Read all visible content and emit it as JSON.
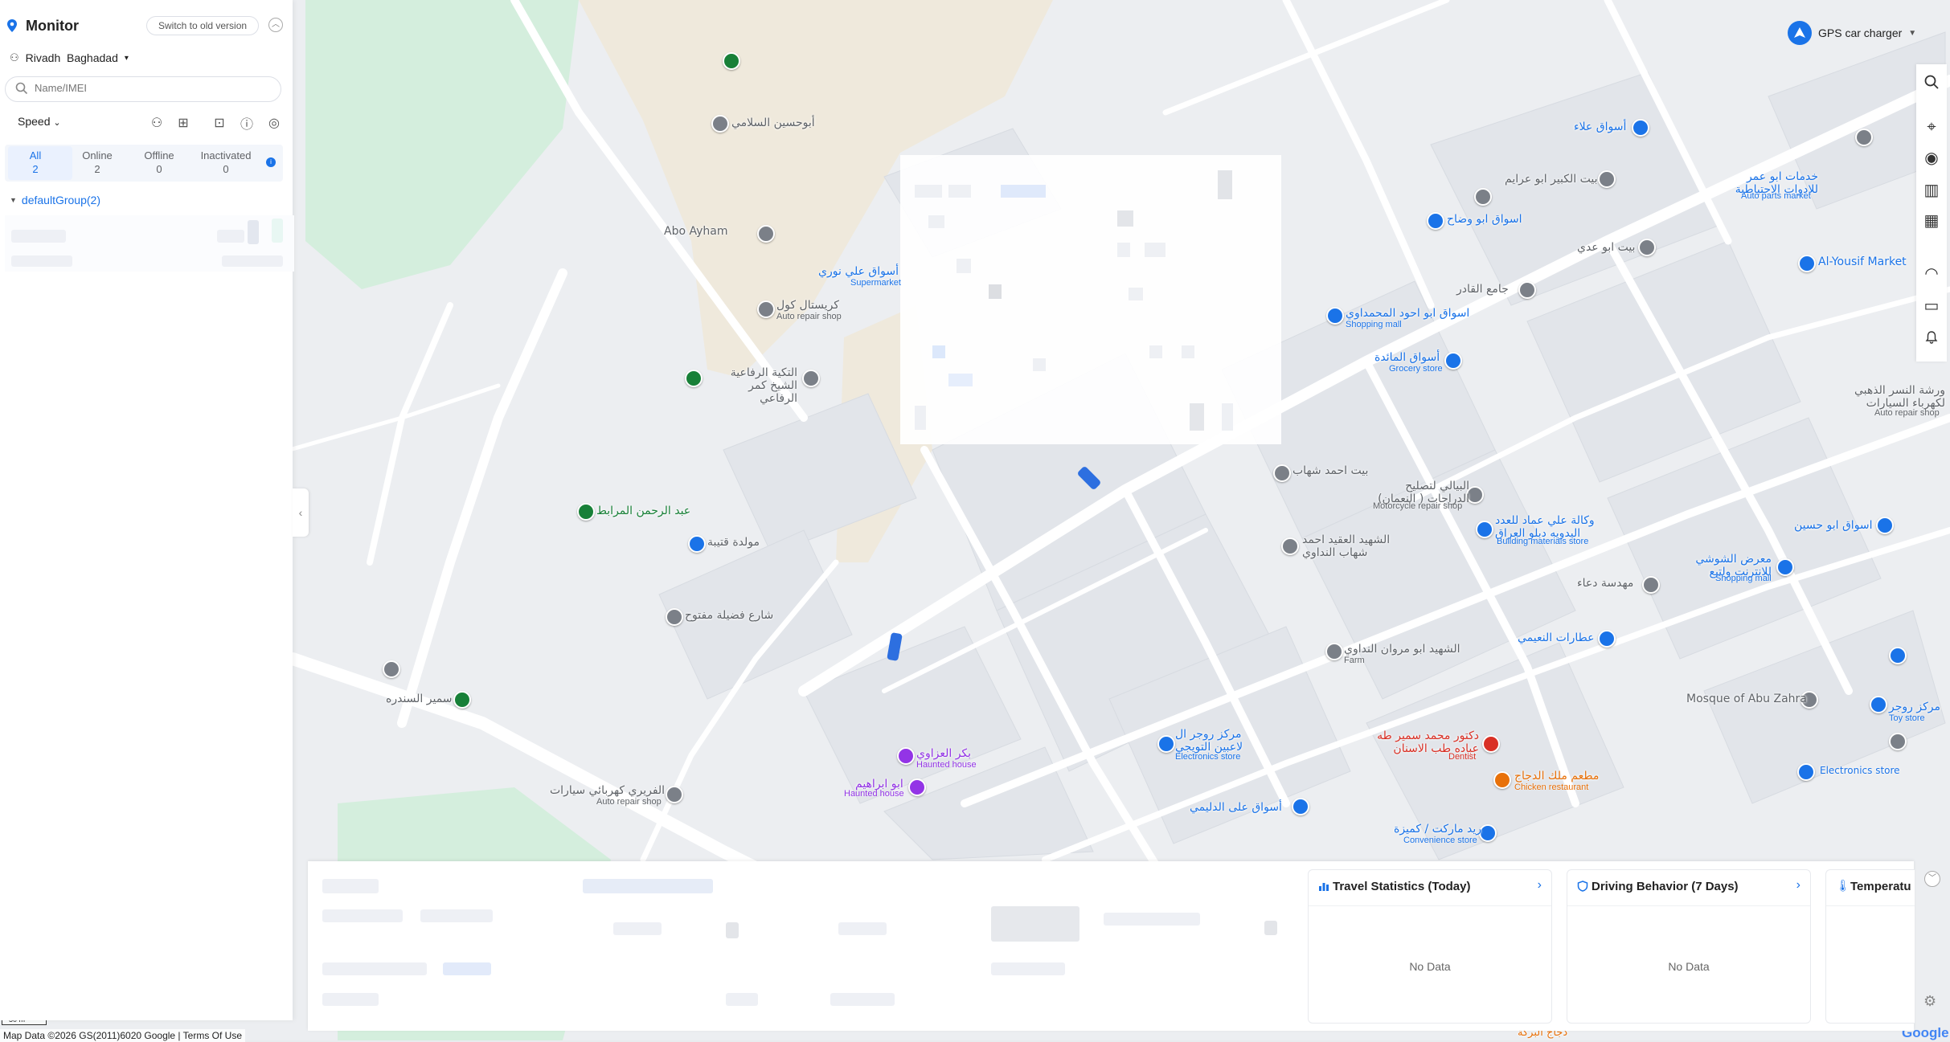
{
  "app": {
    "title": "Monitor",
    "switch_label": "Switch to old version"
  },
  "account": {
    "name": "Rivadh  Baghadad"
  },
  "search": {
    "placeholder": "Name/IMEI"
  },
  "toolbar": {
    "sort_label": "Speed"
  },
  "stats": [
    {
      "label": "All",
      "count": "2"
    },
    {
      "label": "Online",
      "count": "2"
    },
    {
      "label": "Offline",
      "count": "0"
    },
    {
      "label": "Inactivated",
      "count": "0"
    }
  ],
  "group": {
    "label": "defaultGroup(2)"
  },
  "top_right": {
    "label": "GPS car charger"
  },
  "cards": [
    {
      "title": "Travel Statistics (Today)",
      "empty": "No Data"
    },
    {
      "title": "Driving Behavior (7 Days)",
      "empty": "No Data"
    },
    {
      "title": "Temperatu"
    }
  ],
  "map": {
    "places": [
      {
        "text": "أبوحسين السلامي",
        "color": "gray"
      },
      {
        "text": "Abo Ayham",
        "color": "gray"
      },
      {
        "text": "أسواق علي نوري",
        "color": "blue",
        "sub": "Supermarket"
      },
      {
        "text": "كريستال كول",
        "color": "gray",
        "sub": "Auto repair shop"
      },
      {
        "text": "التكية الرفاعية الشيخ كمر الرفاعي",
        "color": "gray"
      },
      {
        "text": "عبد الرحمن المرابط",
        "color": "green"
      },
      {
        "text": "مولدة قتيبة",
        "color": "gray"
      },
      {
        "text": "شارع فضيلة مفتوح",
        "color": "gray"
      },
      {
        "text": "سمير السندره",
        "color": "gray"
      },
      {
        "text": "الفريري كهربائي سيارات",
        "color": "gray",
        "sub": "Auto repair shop"
      },
      {
        "text": "بكر العزاوي",
        "color": "purple",
        "sub": "Haunted house"
      },
      {
        "text": "ابو ابراهيم",
        "color": "purple",
        "sub": "Haunted house"
      },
      {
        "text": "مركز روجر ال لاعبين التويجي",
        "color": "blue",
        "sub": "Electronics store"
      },
      {
        "text": "أسواق على الدليمي",
        "color": "blue"
      },
      {
        "text": "بيت احمد شهاب",
        "color": "gray"
      },
      {
        "text": "الشهيد العقيد احمد شهاب النداوي",
        "color": "gray"
      },
      {
        "text": "الشهيد ابو مروان النداوي",
        "color": "gray",
        "sub": "Farm"
      },
      {
        "text": "البيالي لتصليح الدراجات ( النعمان)",
        "color": "gray",
        "sub": "Motorcycle repair shop"
      },
      {
        "text": "اسواق ابو احود المحمداوي",
        "color": "blue",
        "sub": "Shopping mall"
      },
      {
        "text": "أسواق المائدة",
        "color": "blue",
        "sub": "Grocery store"
      },
      {
        "text": "جامع القادر",
        "color": "gray"
      },
      {
        "text": "بيت ابو عدي",
        "color": "gray"
      },
      {
        "text": "بيت الكبير ابو عرايم",
        "color": "gray"
      },
      {
        "text": "اسواق ابو وضاح",
        "color": "blue"
      },
      {
        "text": "أسواق علاء",
        "color": "blue"
      },
      {
        "text": "Al-Yousif Market",
        "color": "blue"
      },
      {
        "text": "وكالة علي عماد للعدد اليدويه دبلو العراق",
        "color": "blue",
        "sub": "Building materials store"
      },
      {
        "text": "مهدسة دعاء",
        "color": "gray"
      },
      {
        "text": "عطارات النعيمي",
        "color": "blue"
      },
      {
        "text": "دكتور محمد سمير طه عباده طب الاسنان",
        "color": "red",
        "sub": "Dentist"
      },
      {
        "text": "مطعم ملك الدجاج",
        "color": "orange",
        "sub": "Chicken restaurant"
      },
      {
        "text": "ريد ماركت / كميزة",
        "color": "blue",
        "sub": "Convenience store"
      },
      {
        "text": "Mosque of Abu Zahra",
        "color": "gray"
      },
      {
        "text": "معرض الشوشي للانترنت ولتيع",
        "color": "blue",
        "sub": "Shopping mall"
      },
      {
        "text": "اسواق ابو حسين",
        "color": "blue"
      },
      {
        "text": "خدمات ابو عمر للادوات الاحتياطية",
        "color": "blue",
        "sub": "Auto parts market"
      },
      {
        "text": "ورشة النسر الذهبي لكهرباء السيارات",
        "color": "gray",
        "sub": "Auto repair shop"
      },
      {
        "text": "مركز روجر",
        "color": "blue",
        "sub": "Toy store"
      },
      {
        "text": "Electronics store",
        "color": "blue"
      },
      {
        "text": "دجاج البركة",
        "color": "orange"
      }
    ],
    "scale": "50 m",
    "attribution": "Map Data ©2026 GS(2011)6020 Google | Terms Of Use",
    "logo": "Google"
  }
}
